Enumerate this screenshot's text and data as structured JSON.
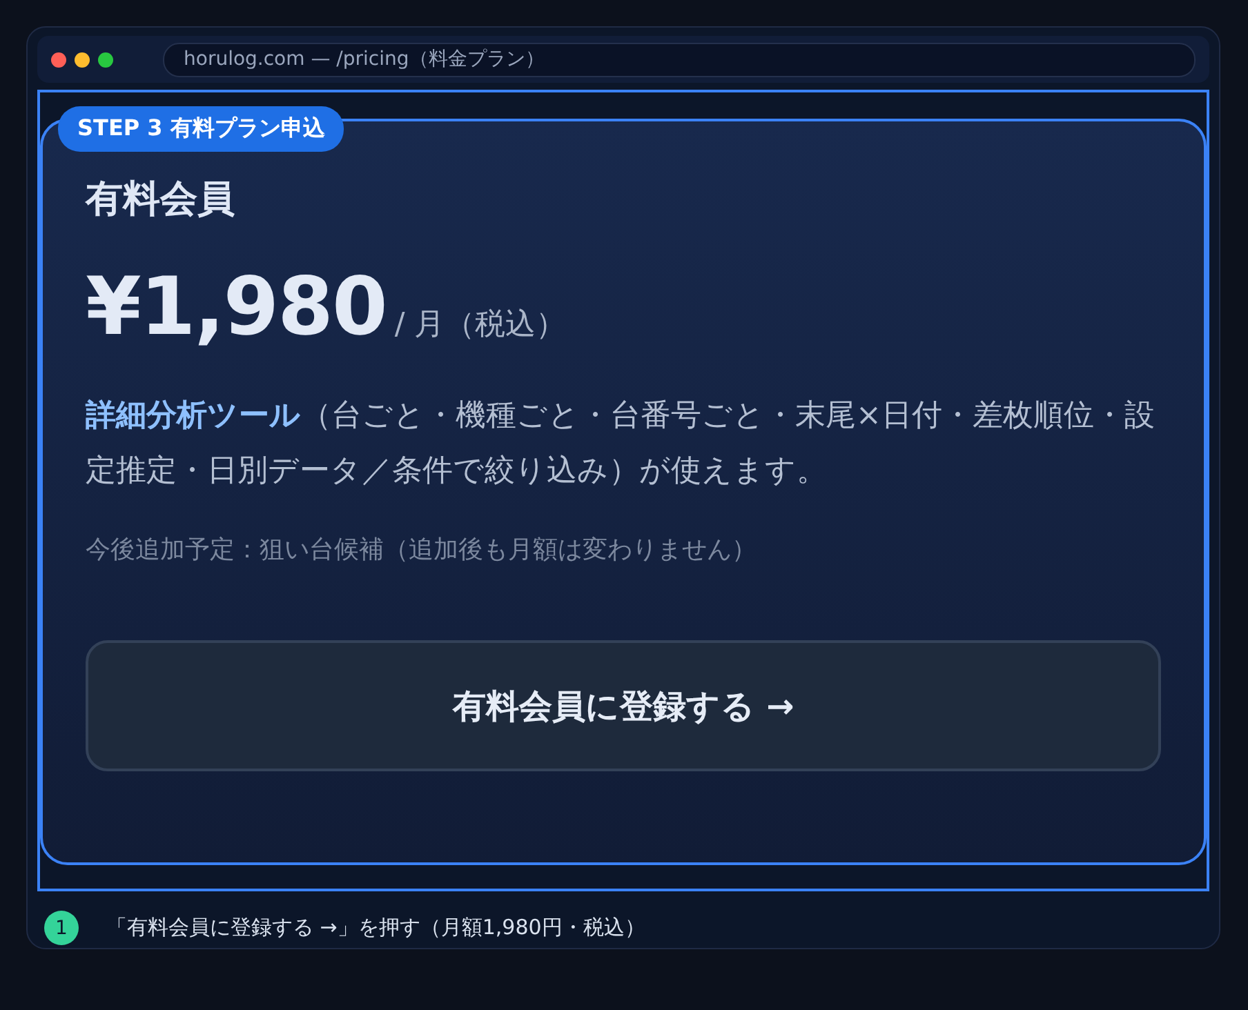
{
  "browser": {
    "url": "horulog.com — /pricing（料金プラン）"
  },
  "card": {
    "badge": "STEP 3 有料プラン申込",
    "title": "有料会員",
    "price": "¥1,980",
    "price_unit": "/ 月（税込）",
    "description": "**詳細分析ツール**（台ごと・機種ごと・台番号ごと・末尾×日付・差枚順位・設定推定・日別データ／条件で絞り込み）が使えます。",
    "note": "今後追加予定：狙い台候補（追加後も月額は変わりません）",
    "button": "有料会員に登録する →"
  },
  "steps": [
    {
      "number": "1",
      "text": "「有料会員に登録する →」を押す（月額1,980円・税込）"
    }
  ]
}
